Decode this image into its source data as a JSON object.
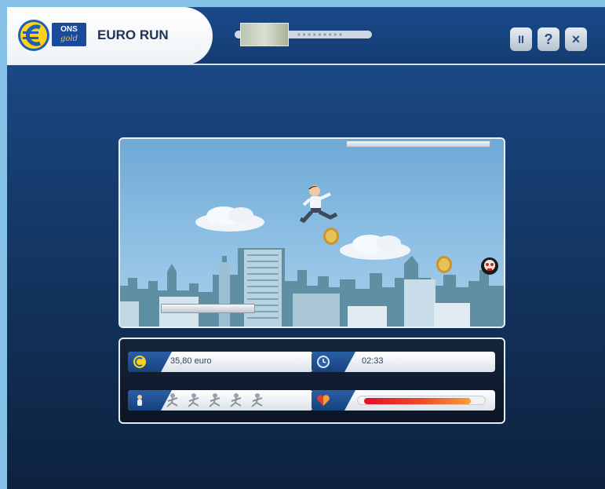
{
  "header": {
    "brand_line1": "ONS",
    "brand_line2": "gold",
    "title": "EURO RUN",
    "pause_label": "II",
    "help_label": "?",
    "close_label": "×"
  },
  "hud": {
    "money": "35,80 euro",
    "time": "02:33",
    "lives": 5,
    "health_fraction": 0.92
  },
  "colors": {
    "background": "#87c3e8",
    "panel_blue": "#1a4a8a",
    "health_start": "#e0102a",
    "health_end": "#f3a03c"
  }
}
